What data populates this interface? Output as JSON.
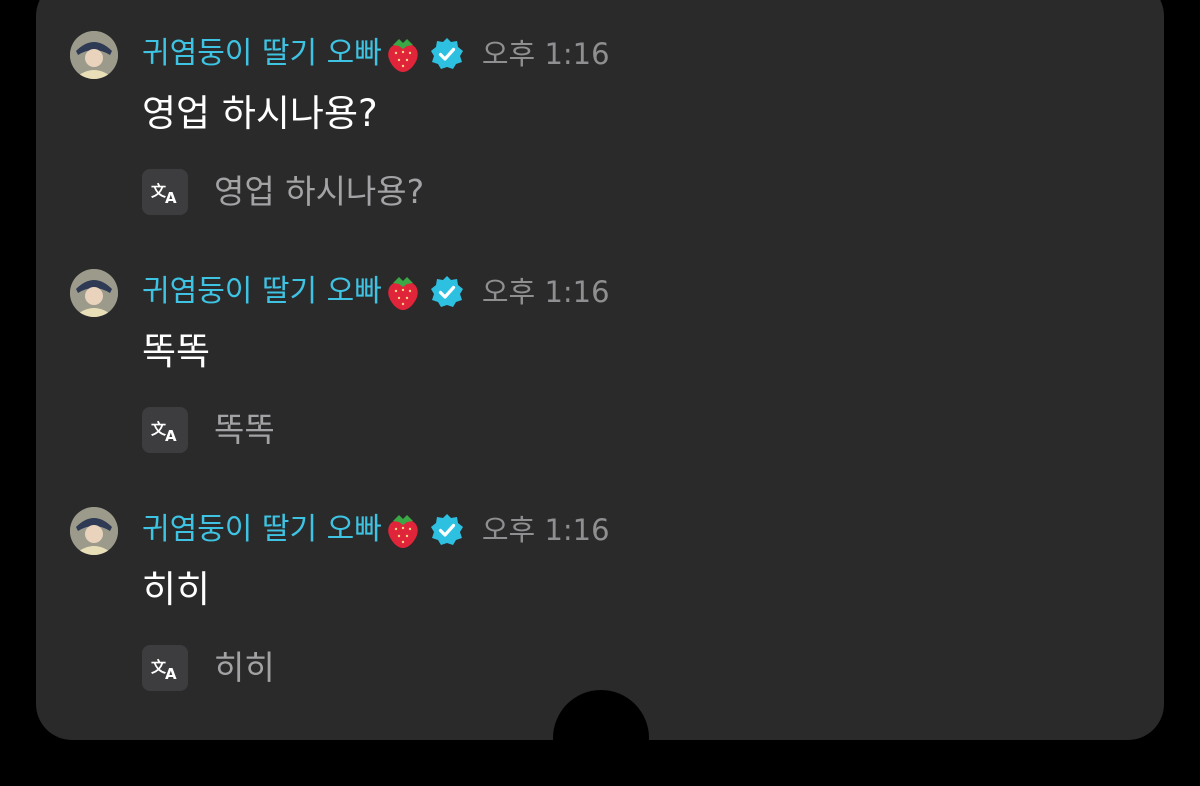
{
  "chat": {
    "messages": [
      {
        "sender": "귀염둥이 딸기 오빠",
        "sender_emoji": "strawberry-emoji",
        "verified_icon": "verified-badge-icon",
        "time": "오후 1:16",
        "text": "영업 하시나용?",
        "translation": "영업 하시나용?"
      },
      {
        "sender": "귀염둥이 딸기 오빠",
        "sender_emoji": "strawberry-emoji",
        "verified_icon": "verified-badge-icon",
        "time": "오후 1:16",
        "text": "똑똑",
        "translation": "똑똑"
      },
      {
        "sender": "귀염둥이 딸기 오빠",
        "sender_emoji": "strawberry-emoji",
        "verified_icon": "verified-badge-icon",
        "time": "오후 1:16",
        "text": "히히",
        "translation": "히히"
      }
    ]
  },
  "colors": {
    "background": "#000000",
    "panel": "#2a2a2b",
    "sender_name": "#3ec3e2",
    "verified_badge": "#2ec0e0",
    "timestamp": "#8f8f92",
    "message_text": "#ffffff",
    "translation_text": "#a3a3a6",
    "translate_button": "#3d3d40"
  }
}
